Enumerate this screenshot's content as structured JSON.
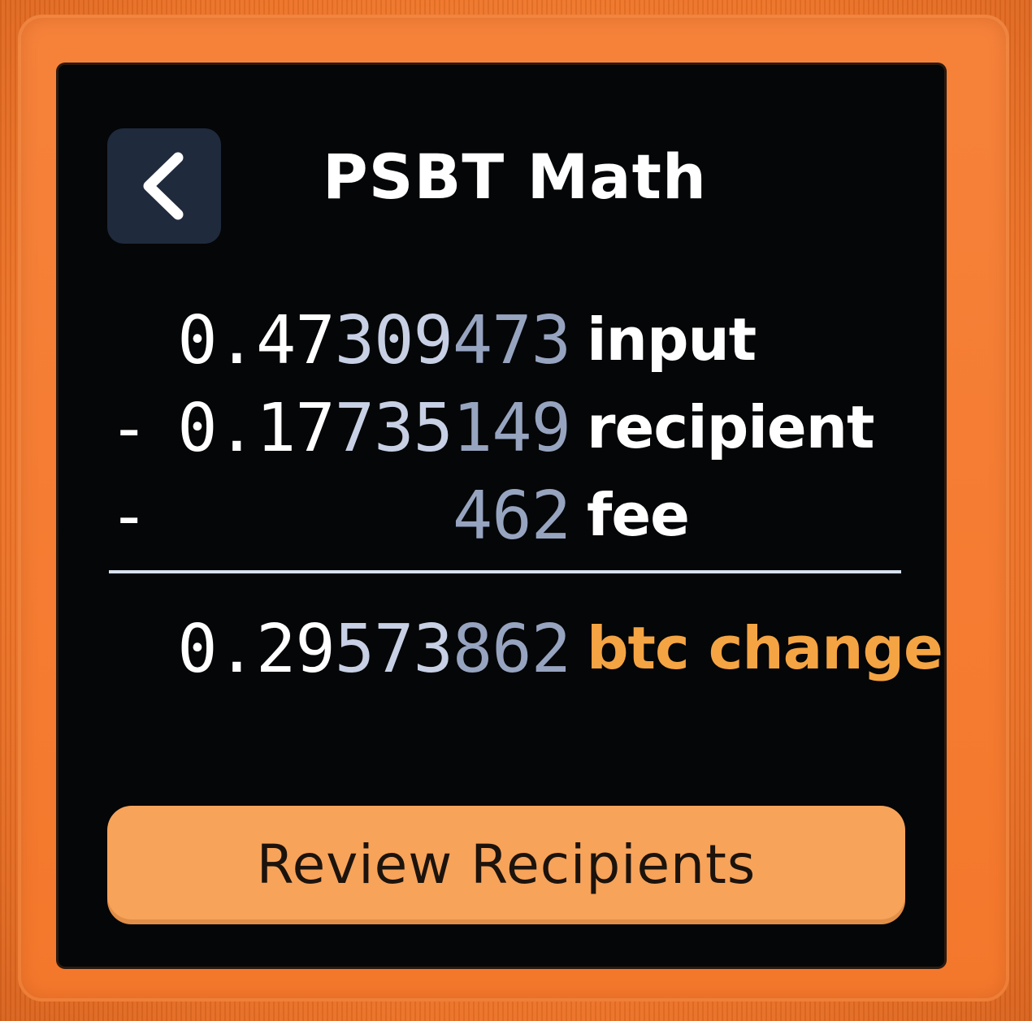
{
  "header": {
    "title": "PSBT Math",
    "back_icon": "chevron-left-icon"
  },
  "math": {
    "input": {
      "sign": "",
      "amount_bright": "0.47",
      "amount_mid": "309",
      "amount_dim": "473",
      "label": "input"
    },
    "recipient": {
      "sign": "-",
      "amount_bright": "0.17",
      "amount_mid": "735",
      "amount_dim": "149",
      "label": "recipient"
    },
    "fee": {
      "sign": "-",
      "amount_bright": "",
      "amount_mid": "",
      "amount_dim": "462",
      "label": "fee"
    },
    "change": {
      "sign": "",
      "amount_bright": "0.29",
      "amount_mid": "573",
      "amount_dim": "862",
      "label": "btc change"
    }
  },
  "footer": {
    "review_button_label": "Review Recipients"
  },
  "colors": {
    "background": "#050607",
    "accent_orange": "#f7a35a",
    "change_label": "#f5a443",
    "back_button": "#1f2a3d",
    "bezel": "#f07a2a"
  }
}
